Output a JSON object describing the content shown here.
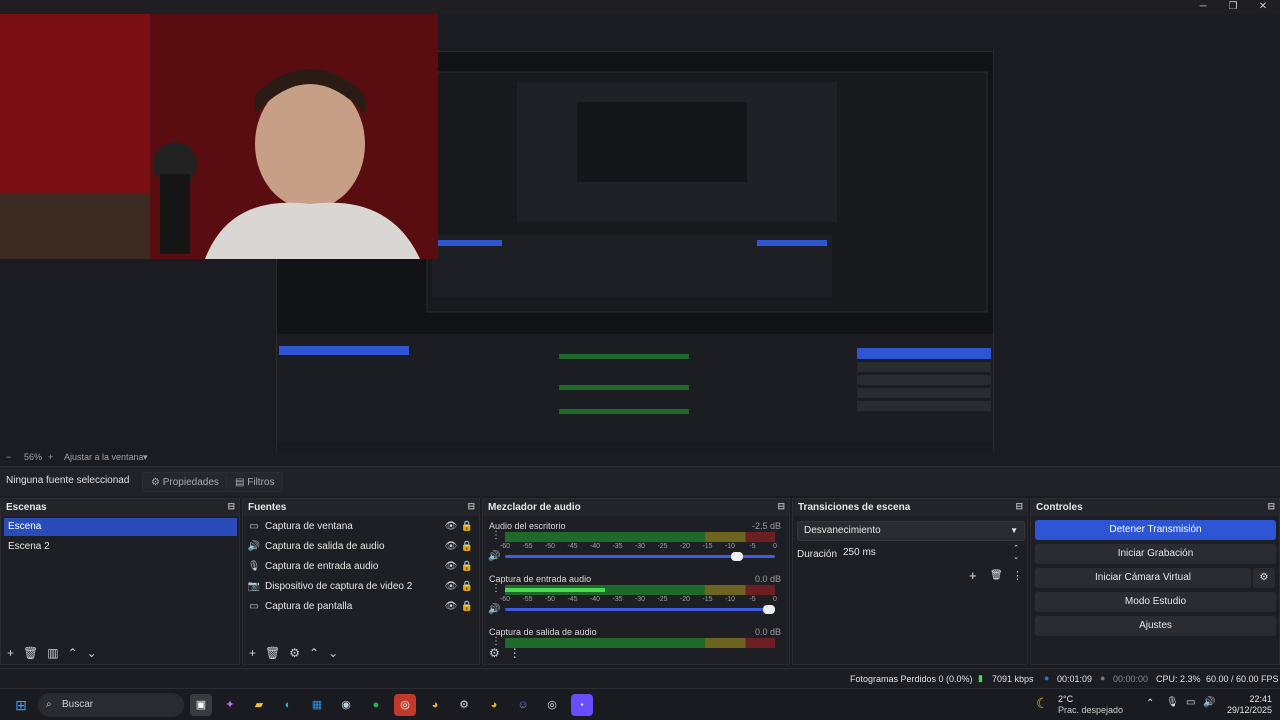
{
  "window": {
    "minimize": "─",
    "maximize": "❐",
    "close": "✕"
  },
  "zoom": {
    "minus": "−",
    "value": "56%",
    "plus": "+",
    "fit_label": "Ajustar a la ventana",
    "caret": "▾"
  },
  "context_bar": {
    "no_source": "Ninguna fuente seleccionad",
    "properties": "Propiedades",
    "filters": "Filtros"
  },
  "scenes": {
    "title": "Escenas",
    "items": [
      "Escena",
      "Escena 2"
    ]
  },
  "sources": {
    "title": "Fuentes",
    "items": [
      {
        "label": "Captura de ventana",
        "icon": "window-icon"
      },
      {
        "label": "Captura de salida de audio",
        "icon": "speaker-icon"
      },
      {
        "label": "Captura de entrada audio",
        "icon": "microphone-icon"
      },
      {
        "label": "Dispositivo de captura de video 2",
        "icon": "camera-icon"
      },
      {
        "label": "Captura de pantalla",
        "icon": "monitor-icon"
      }
    ]
  },
  "mixer": {
    "title": "Mezclador de audio",
    "scale": [
      "-60",
      "-55",
      "-50",
      "-45",
      "-40",
      "-35",
      "-30",
      "-25",
      "-20",
      "-15",
      "-10",
      "-5",
      "0"
    ],
    "channels": [
      {
        "name": "Audio del escritorio",
        "db": "-2.5 dB",
        "level": 0.0
      },
      {
        "name": "Captura de entrada audio",
        "db": "0.0 dB",
        "level": 0.37
      },
      {
        "name": "Captura de salida de audio",
        "db": "0.0 dB",
        "level": 0.0
      }
    ]
  },
  "transitions": {
    "title": "Transiciones de escena",
    "type": "Desvanecimiento",
    "duration_label": "Duración",
    "duration_value": "250 ms"
  },
  "controls": {
    "title": "Controles",
    "buttons": [
      "Detener Transmisión",
      "Iniciar Grabación",
      "Iniciar Cámara Virtual",
      "Modo Estudio",
      "Ajustes"
    ]
  },
  "status": {
    "dropped": "Fotogramas Perdidos 0 (0.0%)",
    "bitrate": "7091 kbps",
    "stream_time": "00:01:09",
    "rec_time": "00:00:00",
    "cpu": "CPU: 2.3%",
    "fps": "60.00 / 60.00 FPS"
  },
  "taskbar": {
    "search": "Buscar",
    "weather_temp": "2°C",
    "weather_desc": "Prac. despejado",
    "time": "22:41",
    "date": "29/12/2025"
  },
  "colors": {
    "accent": "#2d55d4",
    "selection": "#284cb8",
    "meter_green": "#49d84f"
  }
}
